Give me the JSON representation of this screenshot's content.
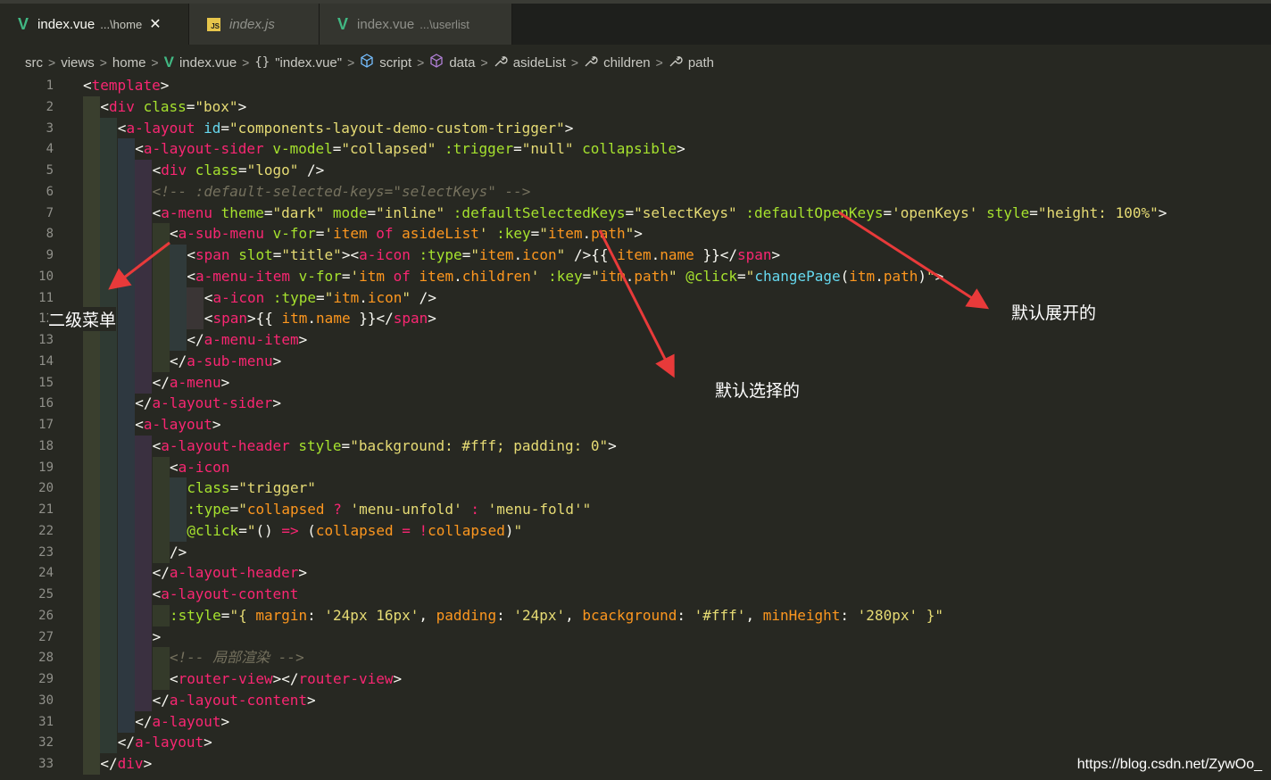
{
  "tabs": [
    {
      "icon": "vue-icon",
      "name": "index.vue",
      "path": "...\\home",
      "close": "✕"
    },
    {
      "icon": "js-icon",
      "icon_text": "JS",
      "name": "index.js"
    },
    {
      "icon": "vue-icon",
      "name": "index.vue",
      "path": "...\\userlist"
    }
  ],
  "breadcrumb": {
    "items": [
      "src",
      "views",
      "home",
      "index.vue",
      "\"index.vue\"",
      "script",
      "data",
      "asideList",
      "children",
      "path"
    ],
    "brace": "{}",
    "separator": ">"
  },
  "code_lines": [
    [
      [
        "p",
        "<"
      ],
      [
        "tg",
        "template"
      ],
      [
        "p",
        ">"
      ]
    ],
    [
      [
        "p",
        "<"
      ],
      [
        "tg",
        "div"
      ],
      [
        "p",
        " "
      ],
      [
        "at",
        "class"
      ],
      [
        "p",
        "="
      ],
      [
        "st",
        "\"box\""
      ],
      [
        "p",
        ">"
      ]
    ],
    [
      [
        "p",
        "<"
      ],
      [
        "tg",
        "a-layout"
      ],
      [
        "p",
        " "
      ],
      [
        "fn",
        "id"
      ],
      [
        "p",
        "="
      ],
      [
        "st",
        "\"components-layout-demo-custom-trigger\""
      ],
      [
        "p",
        ">"
      ]
    ],
    [
      [
        "p",
        "<"
      ],
      [
        "tg",
        "a-layout-sider"
      ],
      [
        "p",
        " "
      ],
      [
        "at",
        "v-model"
      ],
      [
        "p",
        "="
      ],
      [
        "st",
        "\"collapsed\""
      ],
      [
        "p",
        " "
      ],
      [
        "at",
        ":trigger"
      ],
      [
        "p",
        "="
      ],
      [
        "st",
        "\"null\""
      ],
      [
        "p",
        " "
      ],
      [
        "at",
        "collapsible"
      ],
      [
        "p",
        ">"
      ]
    ],
    [
      [
        "p",
        "<"
      ],
      [
        "tg",
        "div"
      ],
      [
        "p",
        " "
      ],
      [
        "at",
        "class"
      ],
      [
        "p",
        "="
      ],
      [
        "st",
        "\"logo\""
      ],
      [
        "p",
        " />"
      ]
    ],
    [
      [
        "cm",
        "<!-- :default-selected-keys=\"selectKeys\" -->"
      ]
    ],
    [
      [
        "p",
        "<"
      ],
      [
        "tg",
        "a-menu"
      ],
      [
        "p",
        " "
      ],
      [
        "at",
        "theme"
      ],
      [
        "p",
        "="
      ],
      [
        "st",
        "\"dark\""
      ],
      [
        "p",
        " "
      ],
      [
        "at",
        "mode"
      ],
      [
        "p",
        "="
      ],
      [
        "st",
        "\"inline\""
      ],
      [
        "p",
        " "
      ],
      [
        "at",
        ":defaultSelectedKeys"
      ],
      [
        "p",
        "="
      ],
      [
        "st",
        "\"selectKeys\""
      ],
      [
        "p",
        " "
      ],
      [
        "at",
        ":defaultOpenKeys"
      ],
      [
        "p",
        "="
      ],
      [
        "st",
        "'openKeys'"
      ],
      [
        "p",
        " "
      ],
      [
        "at",
        "style"
      ],
      [
        "p",
        "="
      ],
      [
        "st",
        "\"height: 100%\""
      ],
      [
        "p",
        ">"
      ]
    ],
    [
      [
        "p",
        "<"
      ],
      [
        "tg",
        "a-sub-menu"
      ],
      [
        "p",
        " "
      ],
      [
        "at",
        "v-for"
      ],
      [
        "p",
        "="
      ],
      [
        "st",
        "'"
      ],
      [
        "vr",
        "item"
      ],
      [
        "p",
        " "
      ],
      [
        "kw",
        "of"
      ],
      [
        "p",
        " "
      ],
      [
        "vr",
        "asideList"
      ],
      [
        "st",
        "'"
      ],
      [
        "p",
        " "
      ],
      [
        "at",
        ":key"
      ],
      [
        "p",
        "="
      ],
      [
        "st",
        "\""
      ],
      [
        "vr",
        "item"
      ],
      [
        "p",
        "."
      ],
      [
        "vr",
        "path"
      ],
      [
        "st",
        "\""
      ],
      [
        "p",
        ">"
      ]
    ],
    [
      [
        "p",
        "<"
      ],
      [
        "tg",
        "span"
      ],
      [
        "p",
        " "
      ],
      [
        "at",
        "slot"
      ],
      [
        "p",
        "="
      ],
      [
        "st",
        "\"title\""
      ],
      [
        "p",
        "><"
      ],
      [
        "tg",
        "a-icon"
      ],
      [
        "p",
        " "
      ],
      [
        "at",
        ":type"
      ],
      [
        "p",
        "="
      ],
      [
        "st",
        "\""
      ],
      [
        "vr",
        "item"
      ],
      [
        "p",
        "."
      ],
      [
        "vr",
        "icon"
      ],
      [
        "st",
        "\""
      ],
      [
        "p",
        " />{{ "
      ],
      [
        "vr",
        "item"
      ],
      [
        "p",
        "."
      ],
      [
        "vr",
        "name"
      ],
      [
        "p",
        " }}</"
      ],
      [
        "tg",
        "span"
      ],
      [
        "p",
        ">"
      ]
    ],
    [
      [
        "p",
        "<"
      ],
      [
        "tg",
        "a-menu-item"
      ],
      [
        "p",
        " "
      ],
      [
        "at",
        "v-for"
      ],
      [
        "p",
        "="
      ],
      [
        "st",
        "'"
      ],
      [
        "vr",
        "itm"
      ],
      [
        "p",
        " "
      ],
      [
        "kw",
        "of"
      ],
      [
        "p",
        " "
      ],
      [
        "vr",
        "item"
      ],
      [
        "p",
        "."
      ],
      [
        "vr",
        "children"
      ],
      [
        "st",
        "'"
      ],
      [
        "p",
        " "
      ],
      [
        "at",
        ":key"
      ],
      [
        "p",
        "="
      ],
      [
        "st",
        "\""
      ],
      [
        "vr",
        "itm"
      ],
      [
        "p",
        "."
      ],
      [
        "vr",
        "path"
      ],
      [
        "st",
        "\""
      ],
      [
        "p",
        " "
      ],
      [
        "at",
        "@click"
      ],
      [
        "p",
        "="
      ],
      [
        "st",
        "\""
      ],
      [
        "fn",
        "changePage"
      ],
      [
        "p",
        "("
      ],
      [
        "vr",
        "itm"
      ],
      [
        "p",
        "."
      ],
      [
        "vr",
        "path"
      ],
      [
        "p",
        ")"
      ],
      [
        "st",
        "\""
      ],
      [
        "p",
        ">"
      ]
    ],
    [
      [
        "p",
        "<"
      ],
      [
        "tg",
        "a-icon"
      ],
      [
        "p",
        " "
      ],
      [
        "at",
        ":type"
      ],
      [
        "p",
        "="
      ],
      [
        "st",
        "\""
      ],
      [
        "vr",
        "itm"
      ],
      [
        "p",
        "."
      ],
      [
        "vr",
        "icon"
      ],
      [
        "st",
        "\""
      ],
      [
        "p",
        " />"
      ]
    ],
    [
      [
        "p",
        "<"
      ],
      [
        "tg",
        "span"
      ],
      [
        "p",
        ">{{ "
      ],
      [
        "vr",
        "itm"
      ],
      [
        "p",
        "."
      ],
      [
        "vr",
        "name"
      ],
      [
        "p",
        " }}</"
      ],
      [
        "tg",
        "span"
      ],
      [
        "p",
        ">"
      ]
    ],
    [
      [
        "p",
        "</"
      ],
      [
        "tg",
        "a-menu-item"
      ],
      [
        "p",
        ">"
      ]
    ],
    [
      [
        "p",
        "</"
      ],
      [
        "tg",
        "a-sub-menu"
      ],
      [
        "p",
        ">"
      ]
    ],
    [
      [
        "p",
        "</"
      ],
      [
        "tg",
        "a-menu"
      ],
      [
        "p",
        ">"
      ]
    ],
    [
      [
        "p",
        "</"
      ],
      [
        "tg",
        "a-layout-sider"
      ],
      [
        "p",
        ">"
      ]
    ],
    [
      [
        "p",
        "<"
      ],
      [
        "tg",
        "a-layout"
      ],
      [
        "p",
        ">"
      ]
    ],
    [
      [
        "p",
        "<"
      ],
      [
        "tg",
        "a-layout-header"
      ],
      [
        "p",
        " "
      ],
      [
        "at",
        "style"
      ],
      [
        "p",
        "="
      ],
      [
        "st",
        "\"background: #fff; padding: 0\""
      ],
      [
        "p",
        ">"
      ]
    ],
    [
      [
        "p",
        "<"
      ],
      [
        "tg",
        "a-icon"
      ]
    ],
    [
      [
        "at",
        "class"
      ],
      [
        "p",
        "="
      ],
      [
        "st",
        "\"trigger\""
      ]
    ],
    [
      [
        "at",
        ":type"
      ],
      [
        "p",
        "="
      ],
      [
        "st",
        "\""
      ],
      [
        "vr",
        "collapsed"
      ],
      [
        "p",
        " "
      ],
      [
        "ob",
        "?"
      ],
      [
        "p",
        " "
      ],
      [
        "st",
        "'menu-unfold'"
      ],
      [
        "p",
        " "
      ],
      [
        "ob",
        ":"
      ],
      [
        "p",
        " "
      ],
      [
        "st",
        "'menu-fold'"
      ],
      [
        "st",
        "\""
      ]
    ],
    [
      [
        "at",
        "@click"
      ],
      [
        "p",
        "="
      ],
      [
        "st",
        "\""
      ],
      [
        "p",
        "() "
      ],
      [
        "ob",
        "=>"
      ],
      [
        "p",
        " ("
      ],
      [
        "vr",
        "collapsed"
      ],
      [
        "p",
        " "
      ],
      [
        "ob",
        "="
      ],
      [
        "p",
        " "
      ],
      [
        "ob",
        "!"
      ],
      [
        "vr",
        "collapsed"
      ],
      [
        "p",
        ")"
      ],
      [
        "st",
        "\""
      ]
    ],
    [
      [
        "p",
        "/>"
      ]
    ],
    [
      [
        "p",
        "</"
      ],
      [
        "tg",
        "a-layout-header"
      ],
      [
        "p",
        ">"
      ]
    ],
    [
      [
        "p",
        "<"
      ],
      [
        "tg",
        "a-layout-content"
      ]
    ],
    [
      [
        "at",
        ":style"
      ],
      [
        "p",
        "="
      ],
      [
        "st",
        "\"{ "
      ],
      [
        "vr",
        "margin"
      ],
      [
        "p",
        ": "
      ],
      [
        "st",
        "'24px 16px'"
      ],
      [
        "p",
        ", "
      ],
      [
        "vr",
        "padding"
      ],
      [
        "p",
        ": "
      ],
      [
        "st",
        "'24px'"
      ],
      [
        "p",
        ", "
      ],
      [
        "vr",
        "bcackground"
      ],
      [
        "p",
        ": "
      ],
      [
        "st",
        "'#fff'"
      ],
      [
        "p",
        ", "
      ],
      [
        "vr",
        "minHeight"
      ],
      [
        "p",
        ": "
      ],
      [
        "st",
        "'280px'"
      ],
      [
        "st",
        " }\""
      ]
    ],
    [
      [
        "p",
        ">"
      ]
    ],
    [
      [
        "cm",
        "<!-- 局部渲染 -->"
      ]
    ],
    [
      [
        "p",
        "<"
      ],
      [
        "tg",
        "router-view"
      ],
      [
        "p",
        "></"
      ],
      [
        "tg",
        "router-view"
      ],
      [
        "p",
        ">"
      ]
    ],
    [
      [
        "p",
        "</"
      ],
      [
        "tg",
        "a-layout-content"
      ],
      [
        "p",
        ">"
      ]
    ],
    [
      [
        "p",
        "</"
      ],
      [
        "tg",
        "a-layout"
      ],
      [
        "p",
        ">"
      ]
    ],
    [
      [
        "p",
        "</"
      ],
      [
        "tg",
        "a-layout"
      ],
      [
        "p",
        ">"
      ]
    ],
    [
      [
        "p",
        "</"
      ],
      [
        "tg",
        "div"
      ],
      [
        "p",
        ">"
      ]
    ]
  ],
  "annotations": {
    "submenu": "二级菜单",
    "default_open": "默认展开的",
    "default_selected": "默认选择的"
  },
  "watermark": "https://blog.csdn.net/ZywOo_",
  "colors": {
    "background": "#272822",
    "tag": "#f92672",
    "attribute": "#a6e22e",
    "string": "#e6db74",
    "comment": "#75715e",
    "variable": "#fd971f",
    "function": "#66d9ef",
    "vue_icon": "#41b883",
    "arrow": "#e83a3a"
  }
}
